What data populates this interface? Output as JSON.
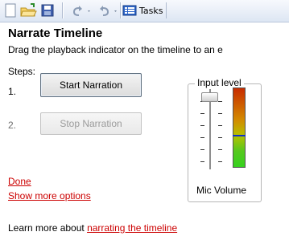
{
  "toolbar": {
    "icons": [
      "new-document-icon",
      "open-folder-icon",
      "save-icon",
      "undo-icon",
      "redo-icon",
      "tasks-icon"
    ],
    "tasks_label": "Tasks"
  },
  "pane": {
    "title": "Narrate Timeline",
    "subtitle": "Drag the playback indicator on the timeline to an e",
    "steps_label": "Steps:",
    "step1_number": "1.",
    "step1_button": "Start Narration",
    "step2_number": "2.",
    "step2_button": "Stop Narration",
    "done_link": "Done",
    "more_options_link": "Show more options",
    "learn_prefix": "Learn more about ",
    "learn_link": "narrating the timeline"
  },
  "input_level": {
    "group_title": "Input level",
    "mic_label": "Mic Volume",
    "volume_level": 0.95,
    "meter_level": 0.4
  },
  "colors": {
    "link": "#cc0000",
    "meter_line": "#1032c8"
  }
}
